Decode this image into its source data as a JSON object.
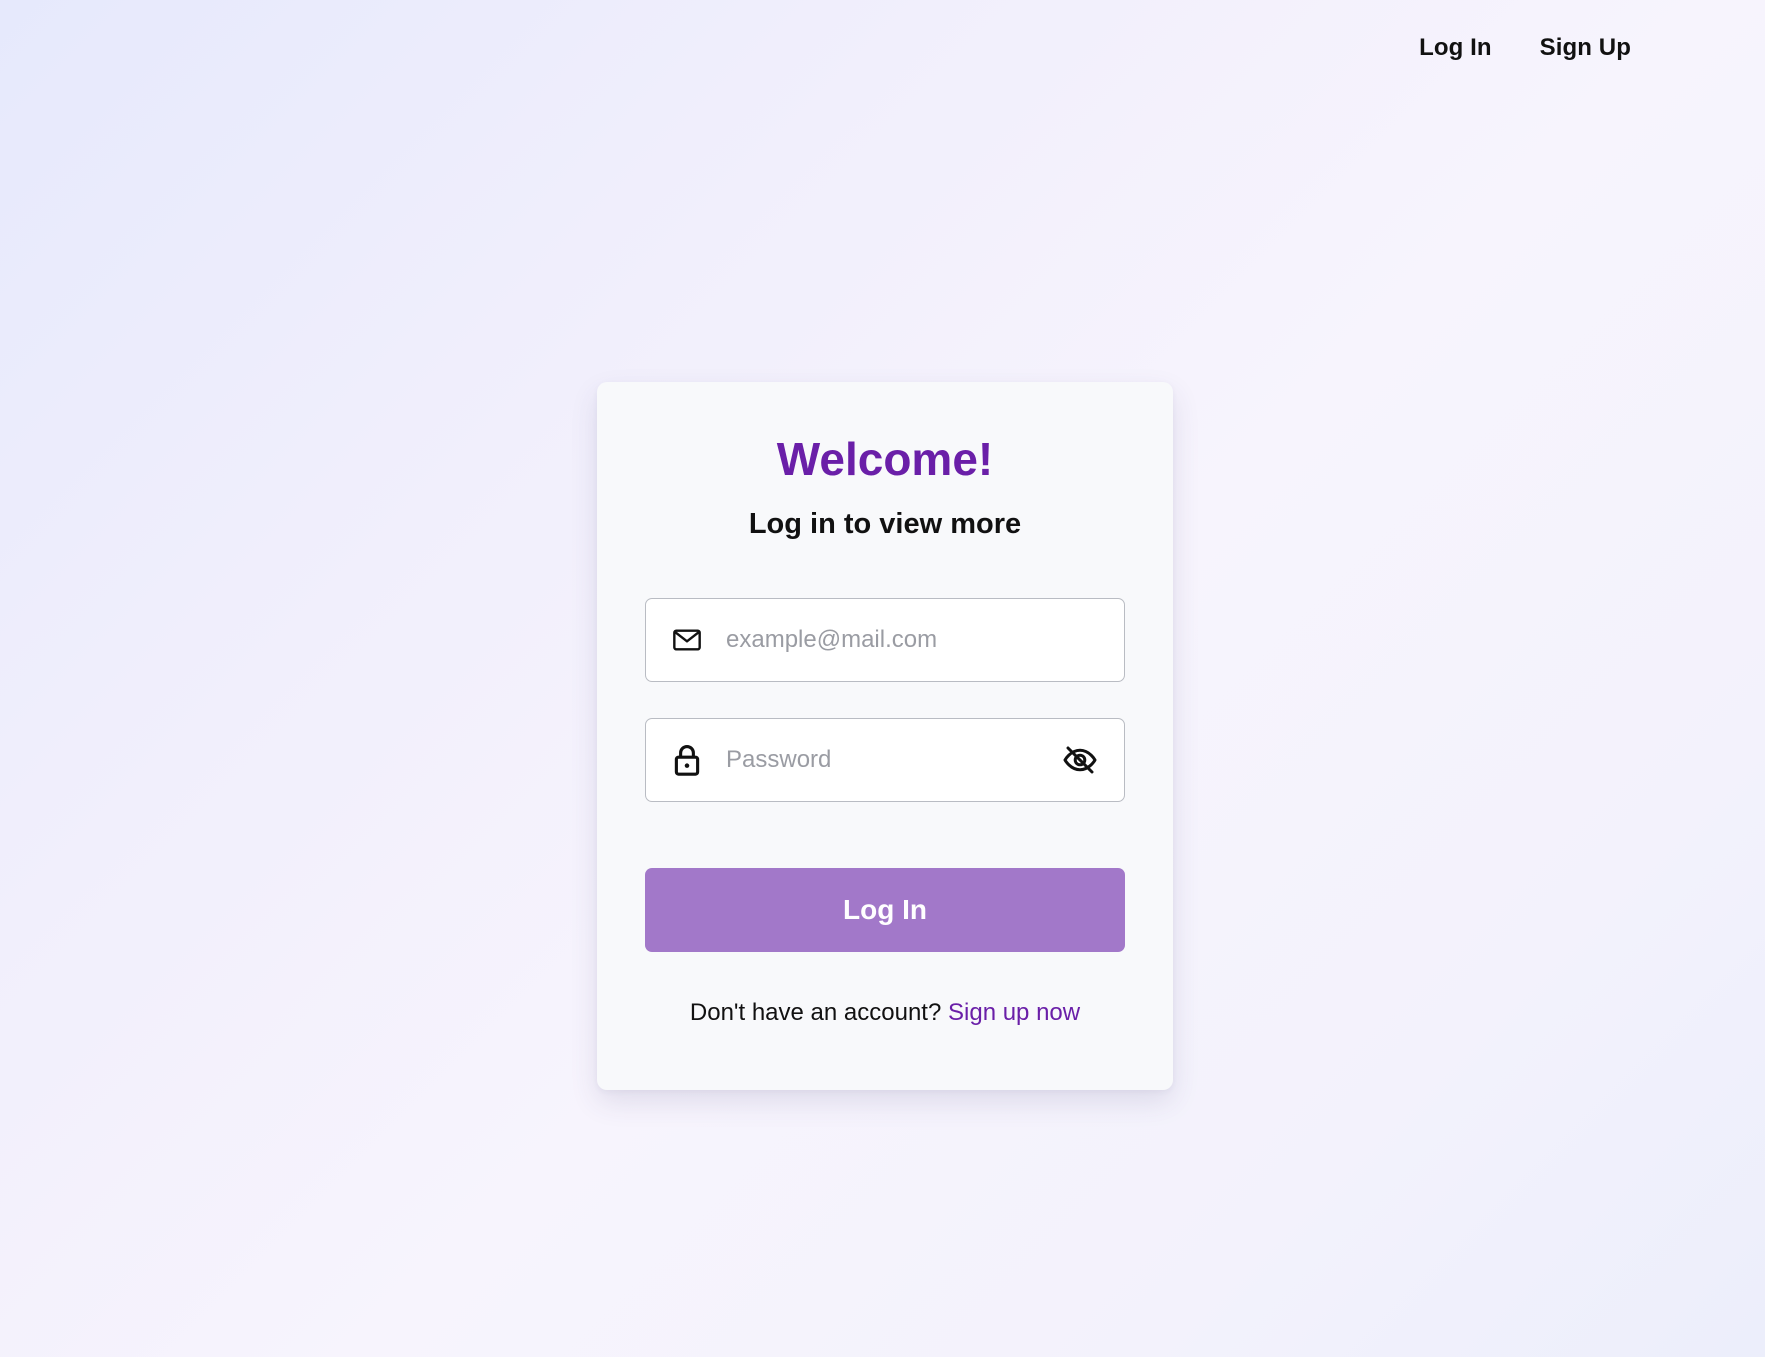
{
  "nav": {
    "login_label": "Log In",
    "signup_label": "Sign Up"
  },
  "card": {
    "title": "Welcome!",
    "subtitle": "Log in to view more",
    "email": {
      "placeholder": "example@mail.com",
      "value": "",
      "icon": "mail-icon"
    },
    "password": {
      "placeholder": "Password",
      "value": "",
      "icon": "lock-icon",
      "toggle_icon": "eye-off-icon"
    },
    "submit_label": "Log In",
    "footer_text": "Don't have an account?",
    "footer_link": "Sign up now"
  },
  "colors": {
    "accent": "#6a1fa8",
    "button": "#a278c9",
    "card_bg": "#f8f9fb"
  }
}
